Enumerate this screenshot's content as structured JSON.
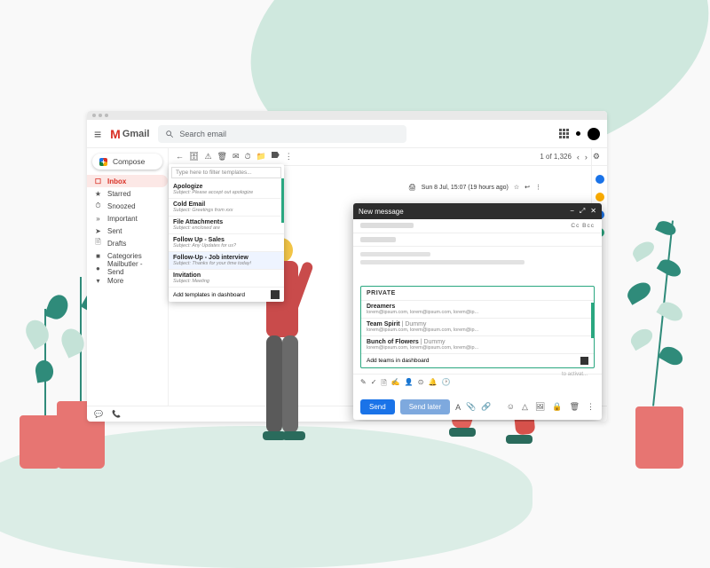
{
  "brand": {
    "name": "Gmail"
  },
  "search": {
    "placeholder": "Search email"
  },
  "compose_button": "Compose",
  "sidebar": {
    "items": [
      {
        "icon": "☐",
        "label": "Inbox"
      },
      {
        "icon": "★",
        "label": "Starred"
      },
      {
        "icon": "⏱",
        "label": "Snoozed"
      },
      {
        "icon": "»",
        "label": "Important"
      },
      {
        "icon": "➤",
        "label": "Sent"
      },
      {
        "icon": "🗎",
        "label": "Drafts"
      },
      {
        "icon": "■",
        "label": "Categories"
      },
      {
        "icon": "●",
        "label": "Mailbutler - Send"
      },
      {
        "icon": "▾",
        "label": "More"
      }
    ]
  },
  "toolbar": {
    "page_info": "1 of 1,326"
  },
  "templates": {
    "filter_placeholder": "Type here to filter templates...",
    "items": [
      {
        "title": "Apologize",
        "subject": "Subject: Please accept out apologize"
      },
      {
        "title": "Cold Email",
        "subject": "Subject: Greetings from xxx"
      },
      {
        "title": "File Attachments",
        "subject": "Subject: enclosed are"
      },
      {
        "title": "Follow Up - Sales",
        "subject": "Subject: Any Updates for us?"
      },
      {
        "title": "Follow-Up - Job interview",
        "subject": "Subject: Thanks for your time today!"
      },
      {
        "title": "Invitation",
        "subject": "Subject: Meeting"
      }
    ],
    "footer_link": "Add templates in dashboard"
  },
  "message_meta": {
    "date": "Sun 8 Jul, 15:07 (19 hours ago)"
  },
  "compose_window": {
    "title": "New message",
    "ccbcc": "Cc Bcc",
    "teams_header": "PRIVATE",
    "teams": [
      {
        "name": "Dreamers",
        "tag": "",
        "members": "lorem@ipsum.com, lorem@ipsum.com, lorem@ip..."
      },
      {
        "name": "Team Spirit",
        "tag": " | Dummy",
        "members": "lorem@ipsum.com, lorem@ipsum.com, lorem@ip..."
      },
      {
        "name": "Bunch of Flowers",
        "tag": " | Dummy",
        "members": "lorem@ipsum.com, lorem@ipsum.com, lorem@ip..."
      }
    ],
    "teams_footer": "Add teams in dashboard",
    "send": "Send",
    "send_later": "Send later",
    "activate_hint": "to activat..."
  }
}
